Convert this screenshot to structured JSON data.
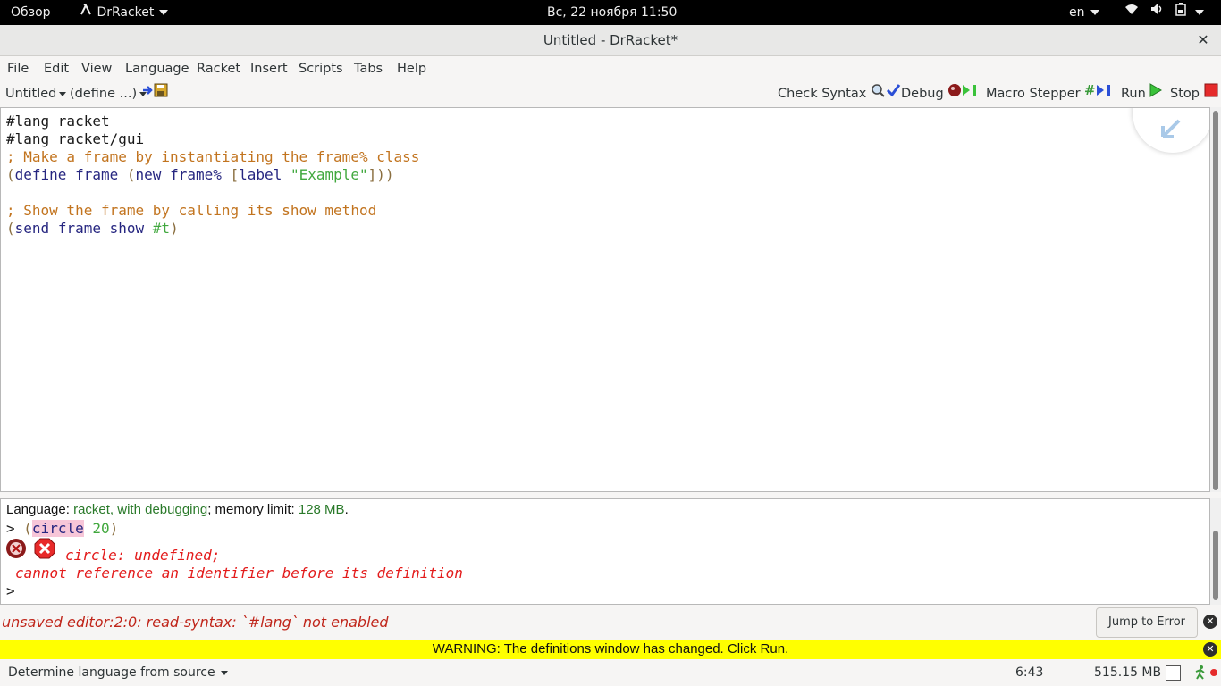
{
  "topbar": {
    "overview": "Обзор",
    "app_name": "DrRacket",
    "clock": "Вс, 22 ноября  11:50",
    "keyboard_layout": "en"
  },
  "window": {
    "title": "Untitled - DrRacket*",
    "close": "✕"
  },
  "menubar": {
    "items": [
      "File",
      "Edit",
      "View",
      "Language",
      "Racket",
      "Insert",
      "Scripts",
      "Tabs",
      "Help"
    ]
  },
  "toolbar": {
    "file_name": "Untitled",
    "define_menu": "(define ...)",
    "check_syntax": "Check Syntax",
    "debug": "Debug",
    "macro_stepper": "Macro Stepper",
    "run": "Run",
    "stop": "Stop"
  },
  "editor": {
    "lines": [
      "#lang racket",
      "#lang racket/gui",
      "; Make a frame by instantiating the frame% class",
      "",
      "",
      "; Show the frame by calling its show method"
    ],
    "define_line": {
      "open1": "(",
      "kw": "define",
      "sp1": " ",
      "name": "frame",
      "sp2": " ",
      "open2": "(",
      "new": "new",
      "sp3": " ",
      "cls": "frame%",
      "sp4": " ",
      "open3": "[",
      "label": "label",
      "sp5": " ",
      "str": "\"Example\"",
      "close": "]))"
    },
    "send_line": {
      "open": "(",
      "send": "send",
      "sp1": " ",
      "frame": "frame",
      "sp2": " ",
      "show": "show",
      "sp3": " ",
      "val": "#t",
      "close": ")"
    }
  },
  "interactions": {
    "lang_prefix": "Language: ",
    "lang_name": "racket, with debugging",
    "mem_prefix": "; memory limit: ",
    "mem_value": "128 MB",
    "mem_suffix": ".",
    "prompt": ">",
    "input_open": "(",
    "input_fn": "circle",
    "input_arg": " 20",
    "input_close": ")",
    "error_line1": "circle: undefined;",
    "error_line2": "cannot reference an identifier before its definition",
    "prompt2": ">"
  },
  "errorbar": {
    "message": "unsaved editor:2:0: read-syntax: `#lang` not enabled",
    "jump_button": "Jump to Error"
  },
  "warning": {
    "message": "WARNING: The definitions window has changed. Click Run."
  },
  "statusbar": {
    "language_selector": "Determine language from source",
    "position": "6:43",
    "memory": "515.15 MB"
  },
  "colors": {
    "warning_bg": "#ffff00",
    "error_text": "#e31b1b",
    "comment": "#c2741f",
    "string": "#41a83e",
    "identifier": "#262680"
  }
}
